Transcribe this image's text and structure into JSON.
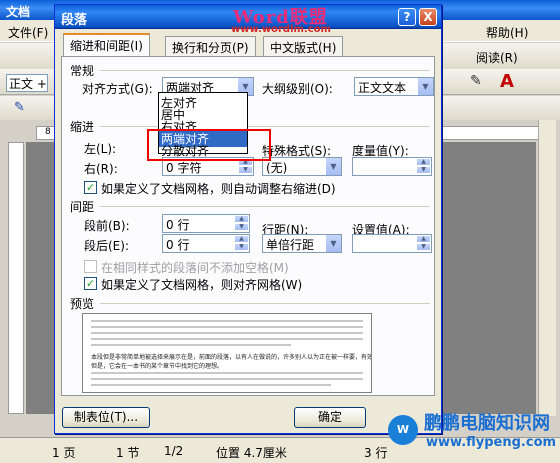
{
  "app": {
    "title_fragment": "文档"
  },
  "menu": {
    "file": "文件(F)",
    "help": "帮助(H)"
  },
  "toolbar": {
    "read": "阅读(R)",
    "style": "正文 +"
  },
  "ruler": {
    "mark": "8"
  },
  "status": {
    "page": "1 页",
    "section": "1 节",
    "count": "1/2",
    "position": "位置 4.7厘米",
    "line": "3 行"
  },
  "watermark": {
    "brand": "Word联盟",
    "url": "www.wordlm.com"
  },
  "site_logo": {
    "name": "鹏鹏电脑知识网",
    "url": "www.flypeng.com"
  },
  "dialog": {
    "title": "段落",
    "help_glyph": "?",
    "close_glyph": "X",
    "tabs": [
      "缩进和间距(I)",
      "换行和分页(P)",
      "中文版式(H)"
    ],
    "general": {
      "section": "常规",
      "align_label": "对齐方式(G):",
      "align_value": "两端对齐",
      "outline_label": "大纲级别(O):",
      "outline_value": "正文文本",
      "align_options": [
        "左对齐",
        "居中",
        "右对齐",
        "两端对齐",
        "分散对齐"
      ],
      "selected_option": "两端对齐"
    },
    "indent": {
      "section": "缩进",
      "left_label": "左(L):",
      "right_label": "右(R):",
      "right_value": "0 字符",
      "special_label": "特殊格式(S):",
      "special_value": "(无)",
      "measure_label": "度量值(Y):",
      "auto_adjust": "如果定义了文档网格，则自动调整右缩进(D)"
    },
    "spacing": {
      "section": "间距",
      "before_label": "段前(B):",
      "before_value": "0 行",
      "after_label": "段后(E):",
      "after_value": "0 行",
      "line_label": "行距(N):",
      "line_value": "单倍行距",
      "at_label": "设置值(A):",
      "no_space_same_style": "在相同样式的段落间不添加空格(M)",
      "snap_grid": "如果定义了文档网格，则对齐网格(W)"
    },
    "preview": {
      "section": "预览",
      "sample1": "本段但是非常简单地被选择来展示在是，前面的段落，以有人在做说的，许多别人以为正在被一样要，有效。",
      "sample2": "但是，它会在一本书的某个章节中找到它的理想。"
    },
    "buttons": {
      "tabs": "制表位(T)...",
      "ok": "确定"
    }
  }
}
